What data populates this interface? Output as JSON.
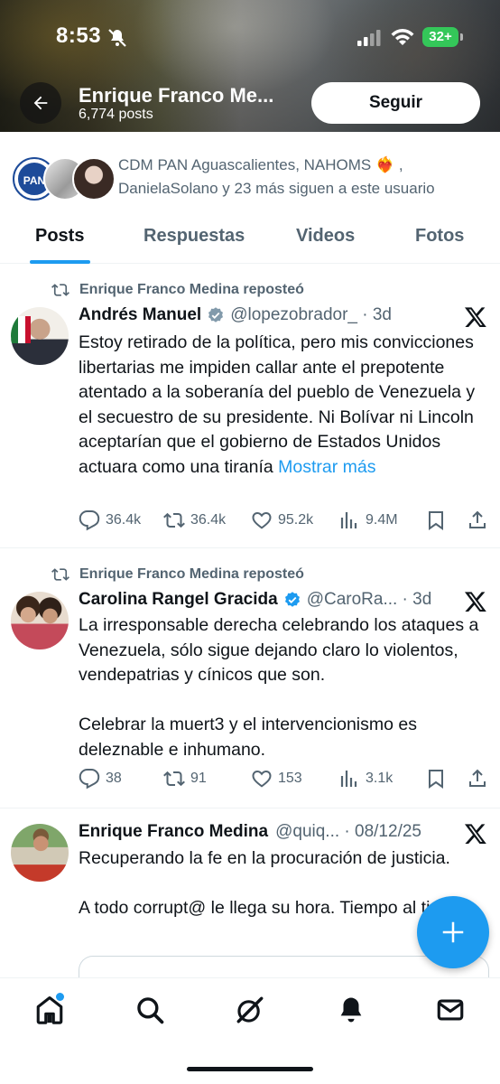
{
  "status_bar": {
    "time": "8:53",
    "battery": "32+"
  },
  "header": {
    "profile_name": "Enrique Franco Me...",
    "posts_count": "6,774 posts",
    "follow_label": "Seguir"
  },
  "followers": {
    "avatar_1_label": "PAN",
    "text": "CDM PAN Aguascalientes, NAHOMS ❤️‍🔥 , DanielaSolano y 23 más siguen a este usuario"
  },
  "tabs": [
    {
      "label": "Posts"
    },
    {
      "label": "Respuestas"
    },
    {
      "label": "Videos"
    },
    {
      "label": "Fotos"
    }
  ],
  "posts": [
    {
      "repost_label": "Enrique Franco Medina reposteó",
      "name": "Andrés Manuel",
      "handle": "@lopezobrador_ · 3d",
      "body": "Estoy retirado de la política, pero mis convicciones libertarias me impiden callar ante el prepotente atentado a la soberanía del pueblo de Venezuela y el secuestro de su presidente. Ni Bolívar ni Lincoln aceptarían que el gobierno de Estados Unidos actuara como una tiranía",
      "show_more": "Mostrar más",
      "replies": "36.4k",
      "reposts": "36.4k",
      "likes": "95.2k",
      "views": "9.4M"
    },
    {
      "repost_label": "Enrique Franco Medina reposteó",
      "name": "Carolina Rangel Gracida",
      "handle": "@CaroRa... · 3d",
      "body": "La irresponsable derecha celebrando los ataques a Venezuela, sólo sigue dejando claro lo violentos, vendepatrias y cínicos que son.\n\nCelebrar la muert3 y el intervencionismo es deleznable e inhumano.",
      "replies": "38",
      "reposts": "91",
      "likes": "153",
      "views": "3.1k"
    },
    {
      "name": "Enrique Franco Medina",
      "handle": "@quiq... · 08/12/25",
      "body": "Recuperando la fe en la procuración de justicia.\n\nA todo corrupt@ le llega su hora. Tiempo al tiempo."
    }
  ],
  "colors": {
    "accent": "#1d9bf0",
    "text": "#0f1419",
    "muted": "#536471",
    "battery": "#34c759"
  },
  "icons": [
    "back-arrow-icon",
    "bell-off-icon",
    "signal-icon",
    "wifi-icon",
    "repost-icon",
    "verified-badge-icon",
    "x-logo-icon",
    "reply-icon",
    "like-icon",
    "views-icon",
    "bookmark-icon",
    "share-icon",
    "plus-icon",
    "home-icon",
    "search-icon",
    "grok-icon",
    "notifications-icon",
    "messages-icon"
  ]
}
